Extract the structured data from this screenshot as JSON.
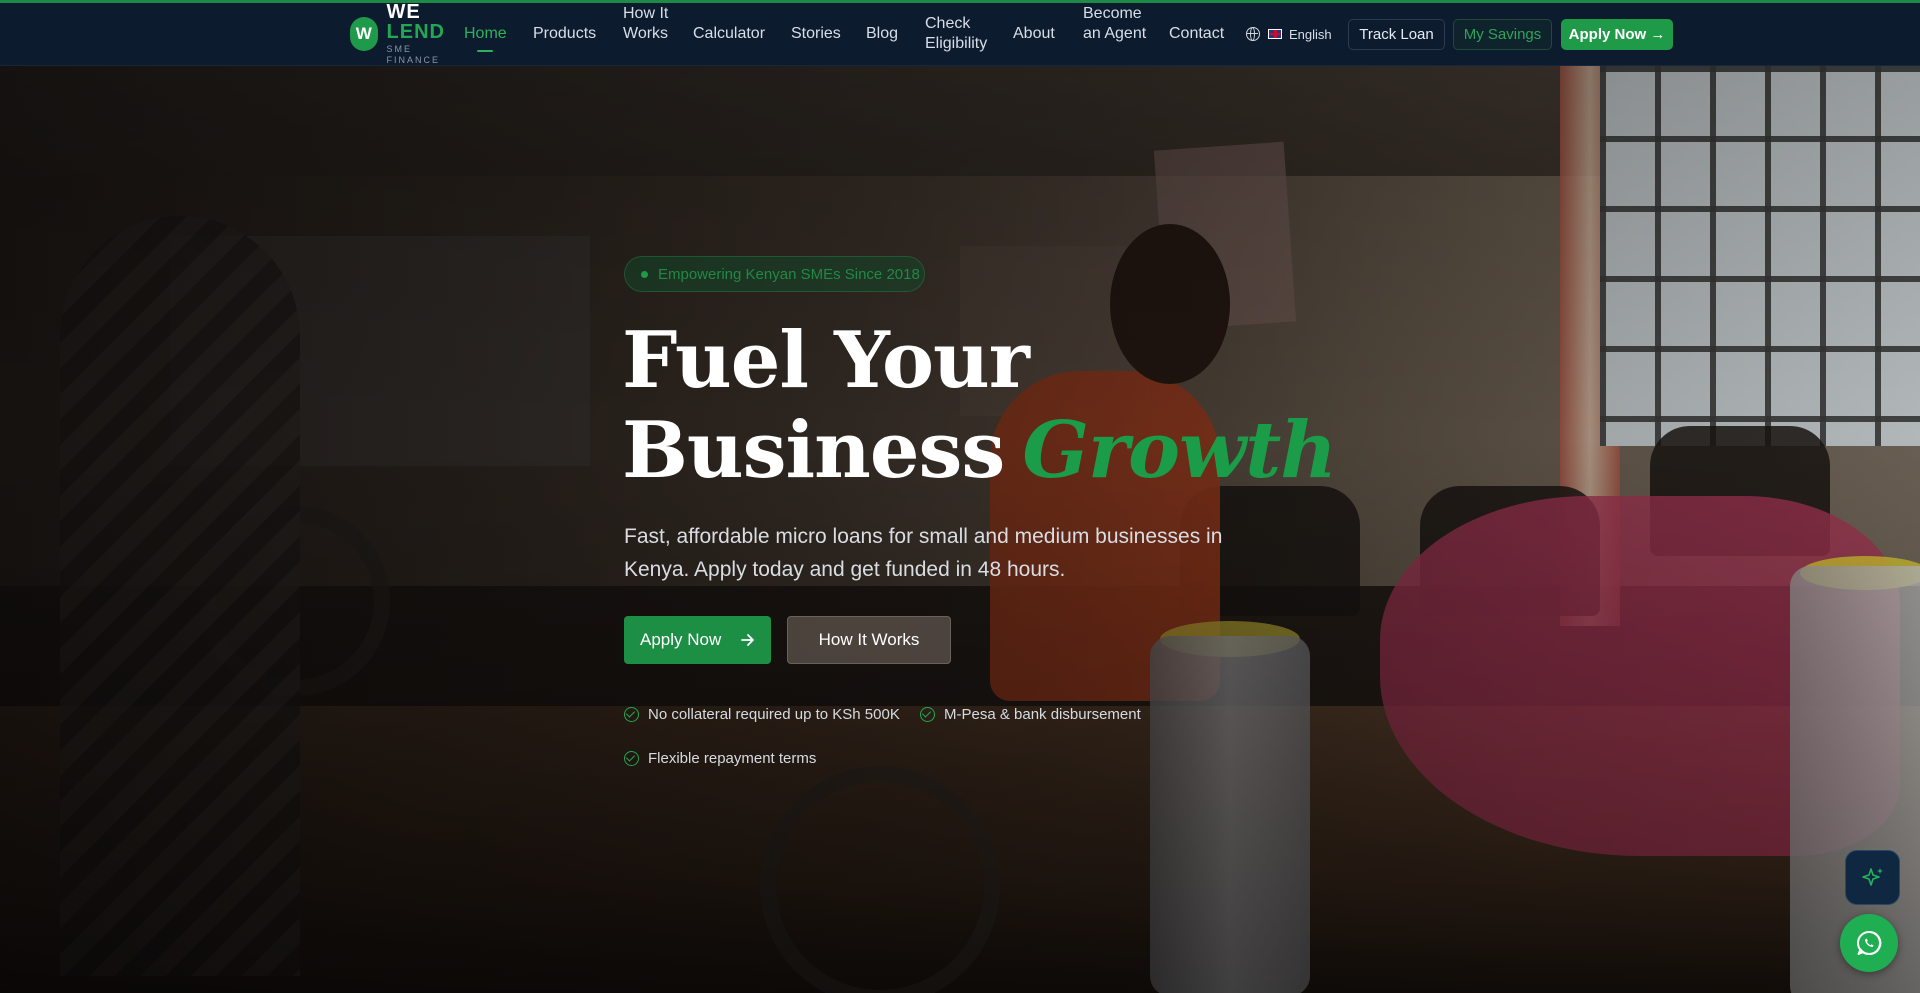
{
  "brand": {
    "badge_letter": "W",
    "word1": "WE",
    "word2": "LEND",
    "tagline": "SME FINANCE"
  },
  "nav": {
    "items": [
      {
        "label": "Home",
        "active": true
      },
      {
        "label": "Products"
      },
      {
        "label": "How It Works"
      },
      {
        "label": "Calculator"
      },
      {
        "label": "Stories"
      },
      {
        "label": "Blog"
      },
      {
        "label": "Check Eligibility"
      },
      {
        "label": "About"
      },
      {
        "label": "Become an Agent"
      },
      {
        "label": "Contact"
      }
    ],
    "language": "English",
    "language_icon": "globe-icon",
    "flag_icon": "uk-flag-icon",
    "track_loan": "Track Loan",
    "my_savings": "My Savings",
    "apply_now": "Apply Now →"
  },
  "hero": {
    "badge": "Empowering Kenyan SMEs Since 2018",
    "title_line1": "Fuel Your",
    "title_line2_main": "Business",
    "title_line2_accent": "Growth",
    "subtitle": "Fast, affordable micro loans for small and medium businesses in Kenya. Apply today and get funded in 48 hours.",
    "primary_button": "Apply Now",
    "secondary_button": "How It Works",
    "features": [
      "No collateral required up to KSh 500K",
      "M-Pesa & bank disbursement",
      "Flexible repayment terms"
    ]
  },
  "floating": {
    "assistant_icon": "sparkle-icon",
    "whatsapp_icon": "whatsapp-icon"
  },
  "colors": {
    "nav_bg": "#0d1b2e",
    "accent": "#1f9a4a",
    "accent_text": "#2bb35c",
    "hero_text": "#ffffff"
  }
}
